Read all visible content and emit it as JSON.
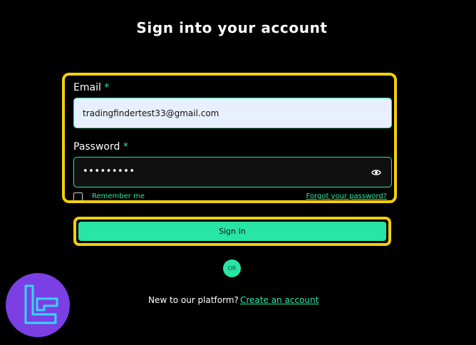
{
  "header": {
    "title": "Sign into your account"
  },
  "form": {
    "email_label": "Email",
    "email_required": "*",
    "email_value": "tradingfindertest33@gmail.com",
    "password_label": "Password",
    "password_required": "*",
    "password_masked": "•••••••••",
    "password_toggle_icon": "eye-icon",
    "remember_label": "Remember me",
    "remember_checked": false,
    "forgot_label": "Forgot your password?"
  },
  "actions": {
    "signin_label": "Sign In",
    "or_label": "OR"
  },
  "footer": {
    "new_text": "New to our platform?",
    "create_label": "Create an account"
  },
  "colors": {
    "background": "#000000",
    "accent": "#27e6a5",
    "highlight": "#f2cf0a",
    "logo_bg": "#7b3fe4",
    "logo_fg": "#35d6f5"
  }
}
